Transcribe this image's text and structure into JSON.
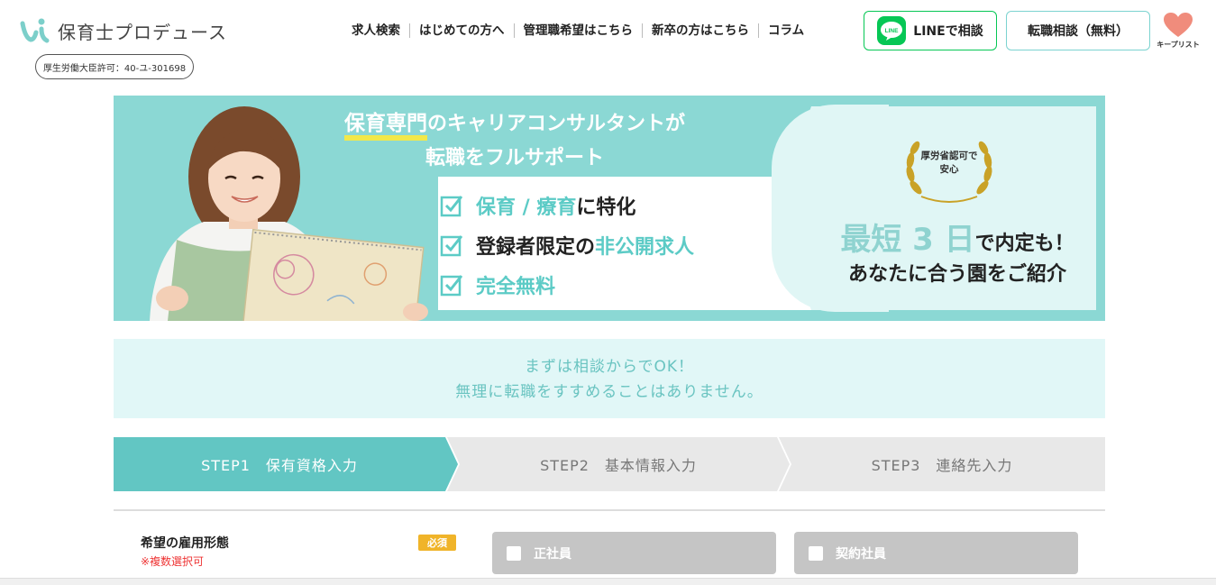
{
  "header": {
    "logo_text": "保育士プロデュース",
    "license": "厚生労働大臣許可：40-ユ-301698",
    "nav": [
      "求人検索",
      "はじめての方へ",
      "管理職希望はこちら",
      "新卒の方はこちら",
      "コラム"
    ],
    "line_button": "LINEで相談",
    "line_badge": "LINE",
    "consult_button": "転職相談（無料）",
    "keeplist_label": "キープリスト"
  },
  "banner": {
    "headline_1a": "保育専門",
    "headline_1b": "のキャリアコンサルタントが",
    "headline_2": "転職をフルサポート",
    "check_1a": "保育 / 療育",
    "check_1b": "に特化",
    "check_2a": "登録者限定の",
    "check_2b": "非公開求人",
    "check_3": "完全無料",
    "laurel_1": "厚労省認可で",
    "laurel_2": "安心",
    "shortest_a": "最短 3 日",
    "shortest_b": "で内定も！",
    "introduce": "あなたに合う園をご紹介"
  },
  "notice": {
    "line1": "まずは相談からでOK！",
    "line2": "無理に転職をすすめることはありません。"
  },
  "steps": [
    {
      "label": "STEP1　保有資格入力",
      "active": true
    },
    {
      "label": "STEP2　基本情報入力",
      "active": false
    },
    {
      "label": "STEP3　連絡先入力",
      "active": false
    }
  ],
  "form": {
    "label": "希望の雇用形態",
    "note": "※複数選択可",
    "required": "必須",
    "options": [
      "正社員",
      "契約社員"
    ]
  },
  "colors": {
    "teal": "#62c6c3",
    "line_green": "#06c755",
    "required_orange": "#f0b429",
    "heart": "#f08c7c"
  }
}
